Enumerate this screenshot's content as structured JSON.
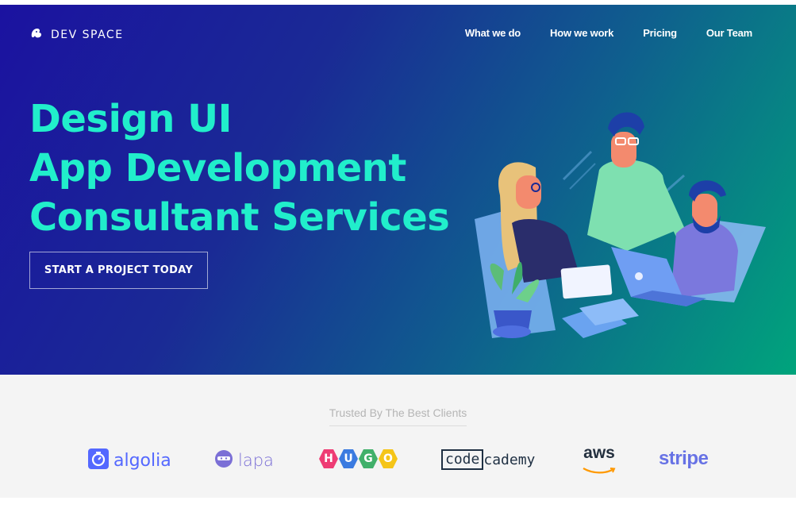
{
  "brand": {
    "name": "DEV SPACE",
    "icon": "squirrel-logo-icon"
  },
  "nav": {
    "items": [
      "What we do",
      "How we work",
      "Pricing",
      "Our Team"
    ]
  },
  "hero": {
    "headline": [
      "Design UI",
      "App Development",
      "Consultant Services"
    ],
    "cta_label": "START A PROJECT TODAY",
    "illustration": "team-working-illustration"
  },
  "clients": {
    "heading": "Trusted By The Best Clients",
    "logos": {
      "algolia": "algolia",
      "lapa": "lapa",
      "hugo": [
        "H",
        "U",
        "G",
        "O"
      ],
      "codecademy_box": "code",
      "codecademy_rest": "cademy",
      "aws": "aws",
      "stripe": "stripe"
    }
  },
  "colors": {
    "headline": "#21eecb",
    "hero_gradient_start": "#1b12a0",
    "hero_gradient_end": "#00a47c",
    "algolia": "#5468ff",
    "lapa": "#7b6fd6",
    "stripe": "#6772e5",
    "aws_orange": "#f90"
  }
}
